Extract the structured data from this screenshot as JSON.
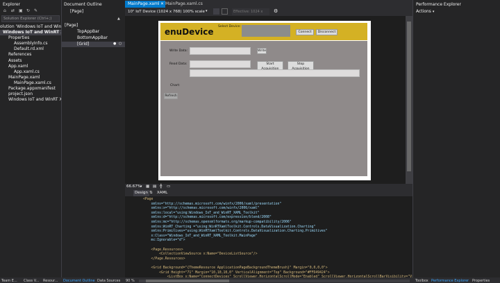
{
  "solution_explorer": {
    "title": "Explorer",
    "search_placeholder": "Solution Explorer (Ctrl+;)",
    "items": [
      "olution 'Windows IoT and WinRT XA",
      "Windows IoT and WinRT XAML",
      "Properties",
      "AssemblyInfo.cs",
      "Default.rd.xml",
      "References",
      "Assets",
      "App.xaml",
      "App.xaml.cs",
      "MainPage.xaml",
      "MainPage.xaml.cs",
      "Package.appxmanifest",
      "project.json",
      "Windows IoT and WinRT XAML"
    ]
  },
  "document_outline": {
    "title": "Document Outline",
    "breadcrumb": "[Page]",
    "items": [
      "[Page]",
      "TopAppBar",
      "BottomAppBar",
      "[Grid]"
    ]
  },
  "editor_tabs": [
    "MainPage.xaml",
    "MainPage.xaml.cs"
  ],
  "designer_toolbar": {
    "device": "10\" IoT Device (1024 x 768) 100% scale",
    "effective": "Effective: 1024 x 768"
  },
  "designer_app": {
    "app_title": "enuDevice",
    "select_device_label": "Select Device:",
    "connect": "Connect",
    "disconnect": "Disconnect",
    "write_label": "Write Data:",
    "write_button": "Write",
    "read_label": "Read Data:",
    "start_acq": "Start Acquisition",
    "stop_acq": "Stop Acquisition",
    "chart_label": "Chart:",
    "refresh": "Refresh"
  },
  "zoom": "66.67%",
  "split_tabs": [
    "Design",
    "XAML"
  ],
  "code_lines": [
    "<Page",
    "    xmlns=\"http://schemas.microsoft.com/winfx/2006/xaml/presentation\"",
    "    xmlns:x=\"http://schemas.microsoft.com/winfx/2006/xaml\"",
    "    xmlns:local=\"using:Windows_IoT_and_WinRT_XAML_Toolkit\"",
    "    xmlns:d=\"http://schemas.microsoft.com/expression/blend/2008\"",
    "    xmlns:mc=\"http://schemas.openxmlformats.org/markup-compatibility/2006\"",
    "    xmlns:WinRT_Charting =\"using:WinRTXamlToolkit.Controls.DataVisualization.Charting\"",
    "    xmlns:Primitives=\"using:WinRTXamlToolkit.Controls.DataVisualization.Charting.Primitives\"",
    "    x:Class=\"Windows_IoT_and_WinRT_XAML_Toolkit.MainPage\"",
    "    mc:Ignorable=\"d\">",
    "",
    "    <Page.Resources>",
    "        <CollectionViewSource x:Name=\"DeviceListSource\"/>",
    "    </Page.Resources>",
    "",
    "    <Grid Background=\"{ThemeResource ApplicationPageBackgroundThemeBrush}\" Margin=\"0,0,0,0\">",
    "        <Grid Height=\"71\" Margin=\"10,10,10,0\" VerticalAlignment=\"Top\" Background=\"#FFD49424\">",
    "            <ListBox x:Name=\"ConnectDevices\" ScrollViewer.HorizontalScrollMode=\"Enabled\" ScrollViewer.HorizontalScrollBarVisibility=\"Visib"
  ],
  "editor_zoom": "90 %",
  "status_tabs_left": [
    "Team E...",
    "Class V...",
    "Resour...",
    "Document Outline",
    "Data Sources"
  ],
  "performance_explorer": {
    "title": "Performance Explorer",
    "actions": "Actions"
  },
  "status_tabs_right": [
    "Toolbox",
    "Performance Explorer",
    "Properties"
  ]
}
